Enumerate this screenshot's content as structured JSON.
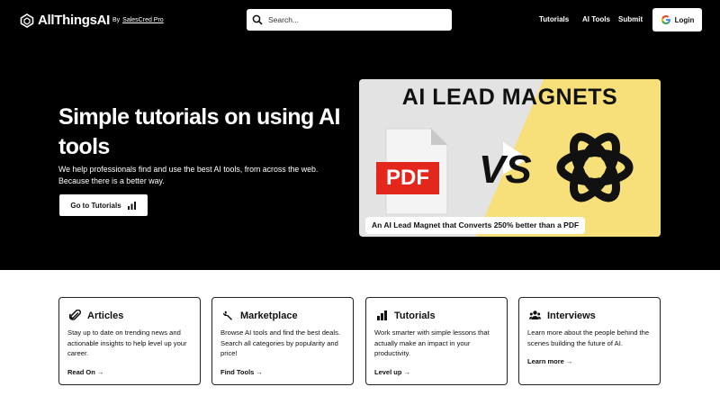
{
  "header": {
    "logo_text": "AllThingsAI",
    "by_label": "By",
    "by_link": "SalesCred Pro",
    "search_placeholder": "Search...",
    "links": [
      "Tutorials",
      "AI Tools",
      "Submit"
    ],
    "login_label": "Login"
  },
  "hero": {
    "title": "Simple tutorials on using AI tools",
    "subtitle": "We help professionals find and use the best AI tools, from across the web. Because there is a better way.",
    "cta_label": "Go to Tutorials",
    "thumbnail": {
      "title": "AI LEAD MAGNETS",
      "pdf_label": "PDF",
      "vs_label": "VS",
      "caption": "An AI Lead Magnet that Converts 250% better than a PDF"
    }
  },
  "cards": [
    {
      "title": "Articles",
      "icon": "paperclip-icon",
      "description": "Stay up to date on trending news and actionable insights to help level up your career.",
      "link": "Read On →"
    },
    {
      "title": "Marketplace",
      "icon": "wrench-icon",
      "description": "Browse AI tools and find the best deals. Search all categories by popularity and price!",
      "link": "Find Tools →"
    },
    {
      "title": "Tutorials",
      "icon": "bar-chart-icon",
      "description": "Work smarter with simple lessons that actually make an impact in your productivity.",
      "link": "Level up →"
    },
    {
      "title": "Interviews",
      "icon": "people-icon",
      "description": "Learn more about the people behind the scenes building the future of AI.",
      "link": "Learn more →"
    }
  ],
  "colors": {
    "hero_bg": "#000000",
    "pdf_red": "#e4271d",
    "thumb_yellow": "#f7e07a"
  }
}
